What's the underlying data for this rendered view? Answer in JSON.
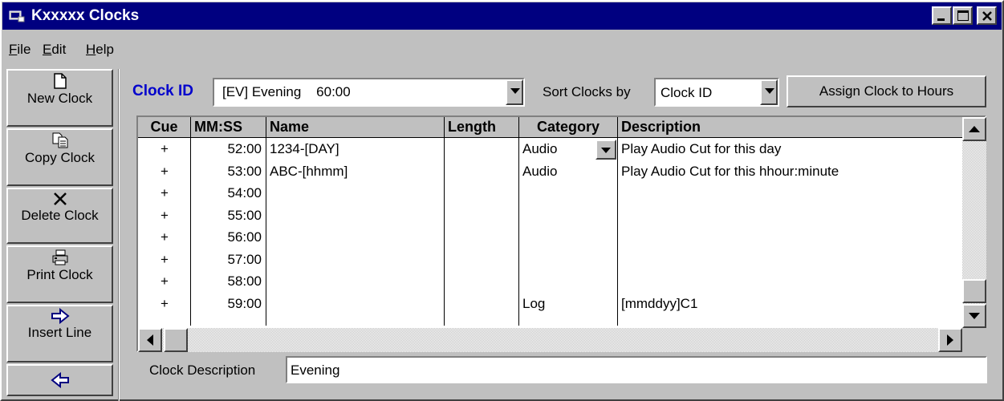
{
  "window": {
    "title": "Kxxxxx Clocks"
  },
  "menu": [
    {
      "label": "File",
      "accel": "F",
      "rest": "ile"
    },
    {
      "label": "Edit",
      "accel": "E",
      "rest": "dit"
    },
    {
      "label": "Help",
      "accel": "H",
      "rest": "elp"
    }
  ],
  "toolbar": {
    "new_clock": "New Clock",
    "copy_clock": "Copy Clock",
    "delete_clock": "Delete Clock",
    "print_clock": "Print Clock",
    "insert_line": "Insert Line"
  },
  "clock_id": {
    "label": "Clock ID",
    "value": "[EV] Evening    60:00"
  },
  "sort": {
    "label": "Sort Clocks by",
    "value": "Clock ID"
  },
  "assign_button": "Assign Clock to Hours",
  "grid": {
    "columns": [
      "Cue",
      "MM:SS",
      "Name",
      "Length",
      "Category",
      "Description"
    ],
    "rows": [
      {
        "cue": "+",
        "time": "52:00",
        "name": "1234-[DAY]",
        "length": "",
        "category": "Audio",
        "description": "Play Audio Cut for this day"
      },
      {
        "cue": "+",
        "time": "53:00",
        "name": "ABC-[hhmm]",
        "length": "",
        "category": "Audio",
        "description": "Play Audio Cut for this hhour:minute"
      },
      {
        "cue": "+",
        "time": "54:00",
        "name": "",
        "length": "",
        "category": "",
        "description": ""
      },
      {
        "cue": "+",
        "time": "55:00",
        "name": "",
        "length": "",
        "category": "",
        "description": ""
      },
      {
        "cue": "+",
        "time": "56:00",
        "name": "",
        "length": "",
        "category": "",
        "description": ""
      },
      {
        "cue": "+",
        "time": "57:00",
        "name": "",
        "length": "",
        "category": "",
        "description": ""
      },
      {
        "cue": "+",
        "time": "58:00",
        "name": "",
        "length": "",
        "category": "",
        "description": ""
      },
      {
        "cue": "+",
        "time": "59:00",
        "name": "",
        "length": "",
        "category": "Log",
        "description": "[mmddyy]C1"
      }
    ]
  },
  "clock_description": {
    "label": "Clock Description",
    "value": "Evening"
  },
  "icons": {
    "app": "app-icon",
    "minimize": "minimize-icon",
    "maximize": "maximize-icon",
    "close": "close-icon",
    "new": "new-document-icon",
    "copy": "copy-icon",
    "delete": "delete-x-icon",
    "print": "printer-icon",
    "insert": "arrow-right-icon",
    "remove": "arrow-left-icon"
  }
}
